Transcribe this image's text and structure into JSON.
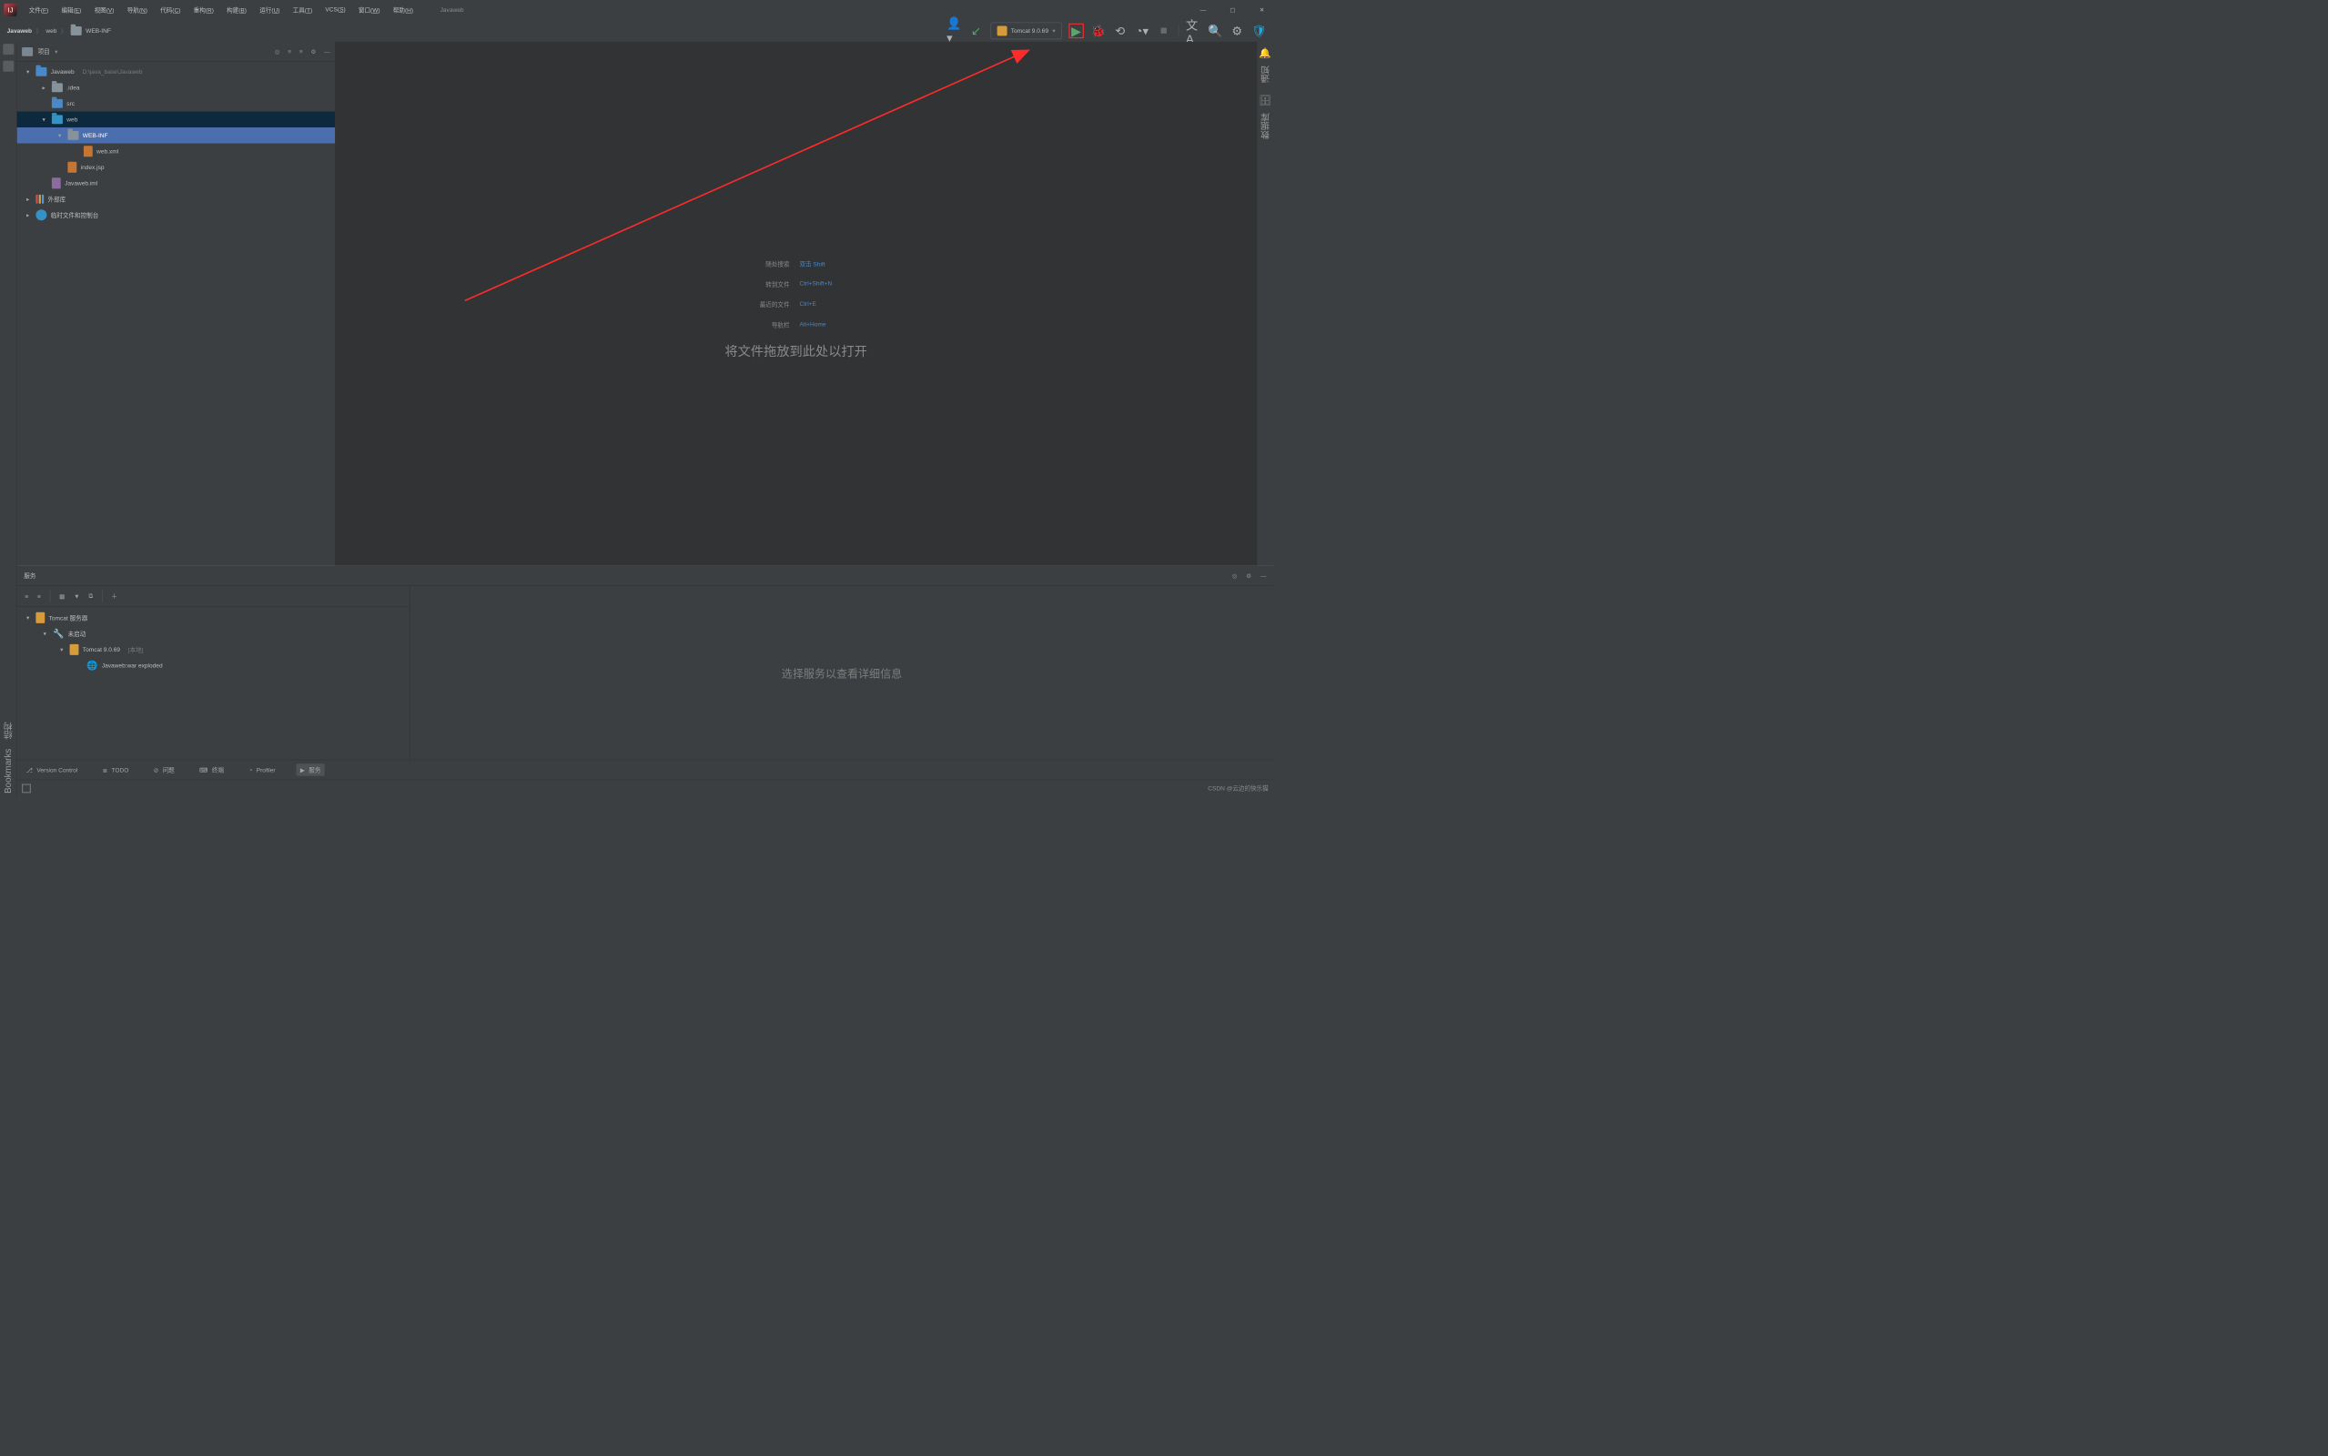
{
  "window": {
    "title": "Javaweb"
  },
  "menu": {
    "items": [
      "文件(F)",
      "编辑(E)",
      "视图(V)",
      "导航(N)",
      "代码(C)",
      "重构(R)",
      "构建(B)",
      "运行(U)",
      "工具(T)",
      "VCS(S)",
      "窗口(W)",
      "帮助(H)"
    ]
  },
  "breadcrumb": {
    "project": "Javaweb",
    "parts": [
      "web",
      "WEB-INF"
    ]
  },
  "toolbar": {
    "run_config": "Tomcat 9.0.69"
  },
  "project_panel": {
    "title": "项目"
  },
  "left_gutter": {
    "structure": "结构",
    "bookmarks": "Bookmarks"
  },
  "right_gutter": {
    "notifications": "通知",
    "database": "数据库"
  },
  "tree": [
    {
      "indent": 0,
      "chev": "▾",
      "icon": "folder-blue",
      "text": "Javaweb",
      "suffix": "D:\\java_base\\Javaweb",
      "cls": ""
    },
    {
      "indent": 1,
      "chev": "▸",
      "icon": "folder",
      "text": ".idea",
      "cls": ""
    },
    {
      "indent": 1,
      "chev": "",
      "icon": "folder-blue",
      "text": "src",
      "cls": ""
    },
    {
      "indent": 1,
      "chev": "▾",
      "icon": "folder-web",
      "text": "web",
      "cls": "selected"
    },
    {
      "indent": 2,
      "chev": "▾",
      "icon": "folder",
      "text": "WEB-INF",
      "cls": "highlight"
    },
    {
      "indent": 3,
      "chev": "",
      "icon": "file-xml",
      "text": "web.xml",
      "cls": ""
    },
    {
      "indent": 2,
      "chev": "",
      "icon": "file-xml",
      "text": "index.jsp",
      "cls": ""
    },
    {
      "indent": 1,
      "chev": "",
      "icon": "file-iml",
      "text": "Javaweb.iml",
      "cls": ""
    },
    {
      "indent": 0,
      "chev": "▸",
      "icon": "lib",
      "text": "外部库",
      "cls": ""
    },
    {
      "indent": 0,
      "chev": "▸",
      "icon": "scratch",
      "text": "临时文件和控制台",
      "cls": ""
    }
  ],
  "hints": {
    "search": {
      "label": "随处搜索",
      "key": "双击 Shift"
    },
    "gotofile": {
      "label": "转到文件",
      "key": "Ctrl+Shift+N"
    },
    "recent": {
      "label": "最近的文件",
      "key": "Ctrl+E"
    },
    "navbar": {
      "label": "导航栏",
      "key": "Alt+Home"
    },
    "drop": "将文件拖放到此处以打开"
  },
  "services": {
    "title": "服务",
    "placeholder": "选择服务以查看详细信息",
    "tree": [
      {
        "indent": 0,
        "chev": "▾",
        "icon": "tom",
        "text": "Tomcat 服务器"
      },
      {
        "indent": 1,
        "chev": "▾",
        "icon": "wrench",
        "text": "未启动"
      },
      {
        "indent": 2,
        "chev": "▾",
        "icon": "tom",
        "text": "Tomcat 9.0.69",
        "suffix": "[本地]"
      },
      {
        "indent": 3,
        "chev": "",
        "icon": "globe",
        "text": "Javaweb:war exploded"
      }
    ]
  },
  "bottom": {
    "vcs": "Version Control",
    "todo": "TODO",
    "problems": "问题",
    "terminal": "终端",
    "profiler": "Profiler",
    "services": "服务"
  },
  "status": {
    "watermark": "CSDN @云边的快乐猫"
  }
}
